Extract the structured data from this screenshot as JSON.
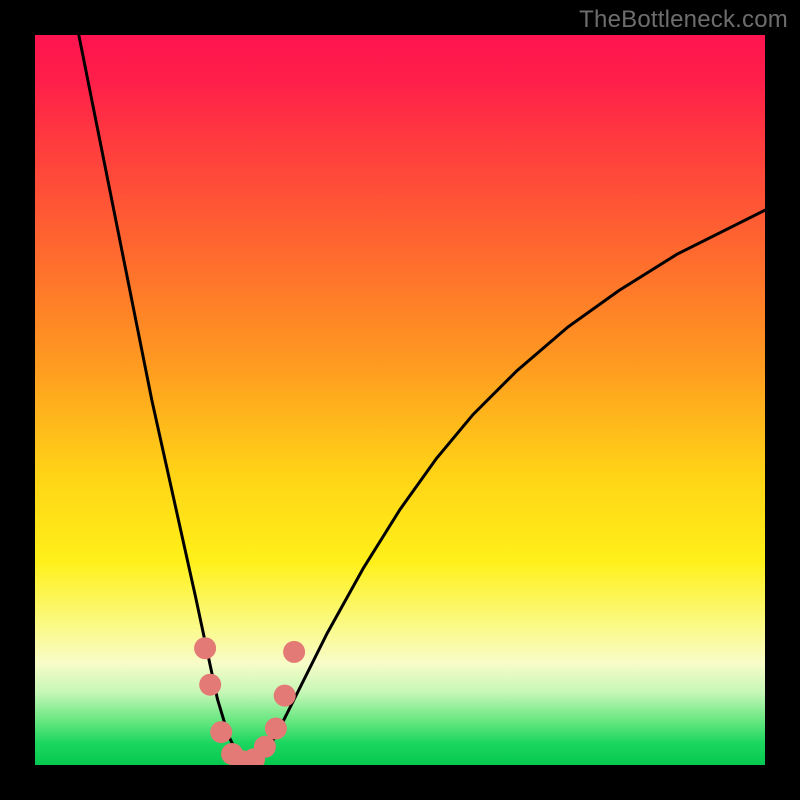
{
  "watermark": "TheBottleneck.com",
  "chart_data": {
    "type": "line",
    "title": "",
    "xlabel": "",
    "ylabel": "",
    "xlim": [
      0,
      100
    ],
    "ylim": [
      0,
      100
    ],
    "background_gradient": {
      "top": "#ff1450",
      "bottom": "#06c950"
    },
    "series": [
      {
        "name": "bottleneck-curve",
        "x": [
          6,
          8,
          10,
          12,
          14,
          16,
          18,
          20,
          22,
          23.5,
          25,
          26.5,
          28,
          29.5,
          31,
          33,
          36,
          40,
          45,
          50,
          55,
          60,
          66,
          73,
          80,
          88,
          96,
          100
        ],
        "y": [
          100,
          90,
          80,
          70,
          60,
          50,
          41,
          32,
          23,
          16,
          9,
          4,
          1,
          0,
          1,
          4,
          10,
          18,
          27,
          35,
          42,
          48,
          54,
          60,
          65,
          70,
          74,
          76
        ],
        "color": "#000000"
      }
    ],
    "markers": {
      "name": "highlight-dots",
      "color": "#e37a76",
      "points": [
        {
          "x": 23.3,
          "y": 16
        },
        {
          "x": 24.0,
          "y": 11
        },
        {
          "x": 25.5,
          "y": 4.5
        },
        {
          "x": 27.0,
          "y": 1.5
        },
        {
          "x": 28.5,
          "y": 0.5
        },
        {
          "x": 30.0,
          "y": 0.8
        },
        {
          "x": 31.5,
          "y": 2.5
        },
        {
          "x": 33.0,
          "y": 5.0
        },
        {
          "x": 34.2,
          "y": 9.5
        },
        {
          "x": 35.5,
          "y": 15.5
        }
      ]
    }
  }
}
